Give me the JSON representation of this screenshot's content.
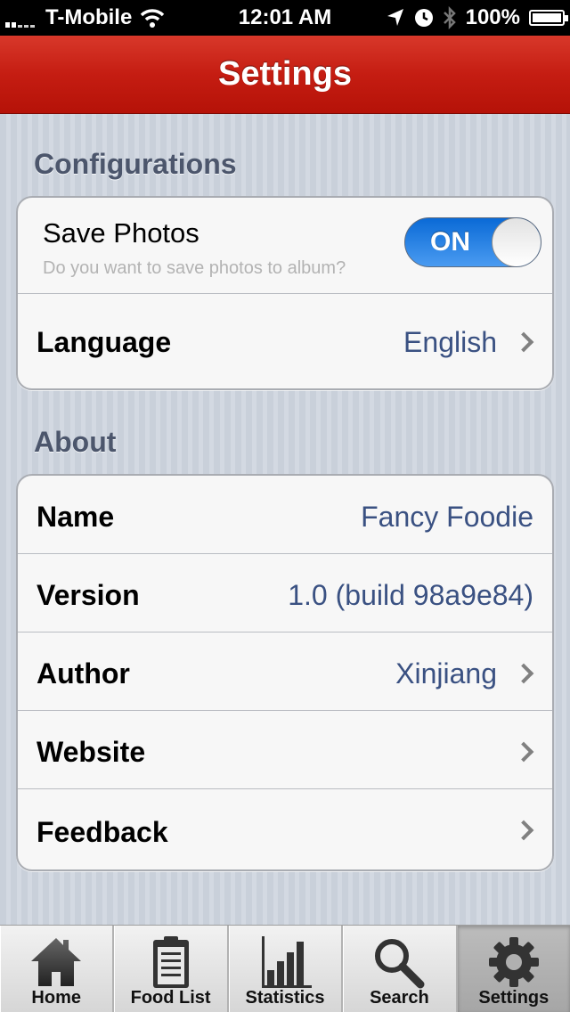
{
  "status_bar": {
    "carrier": "T-Mobile",
    "time": "12:01 AM",
    "battery": "100%",
    "icons": [
      "signal-icon",
      "wifi-icon",
      "location-arrow-icon",
      "clock-icon",
      "bluetooth-icon",
      "battery-icon"
    ]
  },
  "navbar": {
    "title": "Settings"
  },
  "configurations": {
    "header": "Configurations",
    "save_photos": {
      "title": "Save Photos",
      "subtitle": "Do you want to save photos to album?",
      "toggle_label": "ON",
      "toggle_on": true
    },
    "language": {
      "label": "Language",
      "value": "English"
    }
  },
  "about": {
    "header": "About",
    "name": {
      "label": "Name",
      "value": "Fancy Foodie"
    },
    "version": {
      "label": "Version",
      "value": "1.0 (build 98a9e84)"
    },
    "author": {
      "label": "Author",
      "value": "Xinjiang"
    },
    "website": {
      "label": "Website"
    },
    "feedback": {
      "label": "Feedback"
    }
  },
  "tabbar": {
    "tabs": [
      {
        "label": "Home",
        "icon": "home-icon"
      },
      {
        "label": "Food List",
        "icon": "clipboard-icon"
      },
      {
        "label": "Statistics",
        "icon": "bar-chart-icon"
      },
      {
        "label": "Search",
        "icon": "search-icon"
      },
      {
        "label": "Settings",
        "icon": "gear-icon",
        "selected": true
      }
    ]
  },
  "colors": {
    "nav_red": "#c51d12",
    "value_blue": "#3a5182",
    "toggle_blue": "#1a78e0",
    "header_slate": "#4c566c"
  }
}
